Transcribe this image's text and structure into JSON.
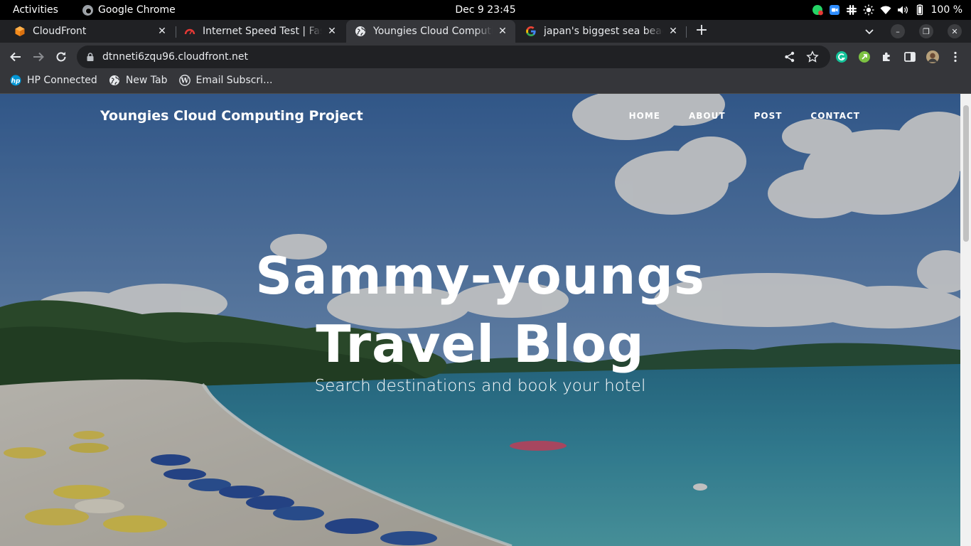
{
  "system_bar": {
    "activities_label": "Activities",
    "app_name": "Google Chrome",
    "datetime": "Dec 9  23:45",
    "battery_percent": "100 %"
  },
  "tabs": [
    {
      "title": "CloudFront",
      "icon": "aws-cube-icon",
      "active": false
    },
    {
      "title": "Internet Speed Test | Fast.com",
      "icon": "speedometer-icon",
      "active": false
    },
    {
      "title": "Youngies Cloud Computing Project",
      "icon": "globe-icon",
      "active": true
    },
    {
      "title": "japan's biggest sea beach - Google Search",
      "icon": "google-icon",
      "active": false
    }
  ],
  "toolbar": {
    "url": "dtnneti6zqu96.cloudfront.net"
  },
  "bookmarks": [
    {
      "label": "HP Connected",
      "icon": "hp-icon"
    },
    {
      "label": "New Tab",
      "icon": "globe-icon"
    },
    {
      "label": "Email Subscri...",
      "icon": "wordpress-icon"
    }
  ],
  "site": {
    "brand": "Youngies Cloud Computing Project",
    "nav": [
      "HOME",
      "ABOUT",
      "POST",
      "CONTACT"
    ],
    "hero_title_line1": "Sammy-youngs",
    "hero_title_line2": "Travel Blog",
    "hero_subtitle": "Search destinations and book your hotel"
  },
  "colors": {
    "chrome_frame": "#202124",
    "chrome_toolbar": "#35363a",
    "hero_sky": "#4f7fb8",
    "hero_sea": "#3d97b0",
    "hero_sand": "#d9d6cf"
  }
}
